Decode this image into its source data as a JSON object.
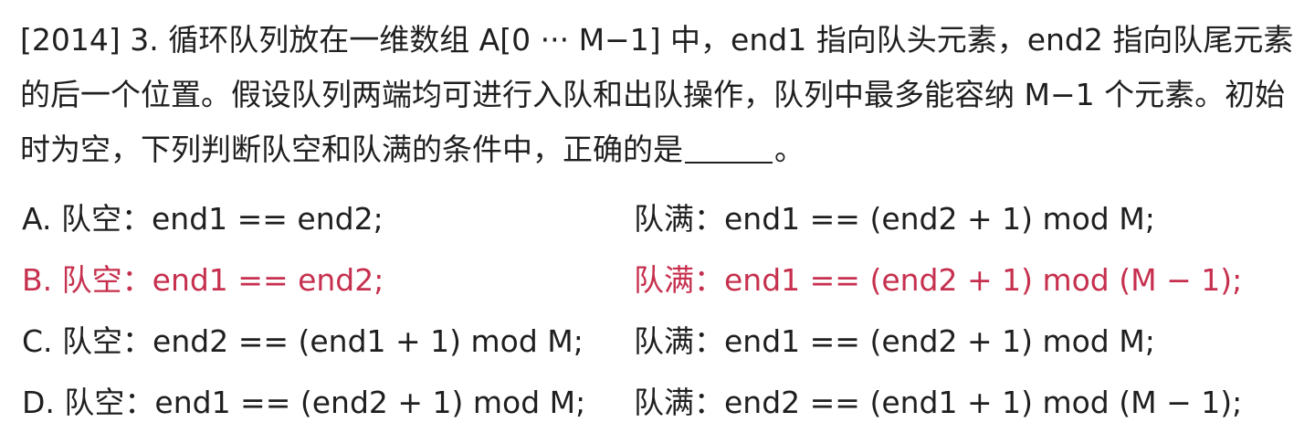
{
  "question": {
    "text": "[2014] 3. 循环队列放在一维数组 A[0 ··· M−1] 中，end1 指向队头元素，end2 指向队尾元素的后一个位置。假设队列两端均可进行入队和出队操作，队列中最多能容纳 M−1 个元素。初始时为空，下列判断队空和队满的条件中，正确的是",
    "tail": "。"
  },
  "options": [
    {
      "label": "A.",
      "empty": "队空：end1 == end2;",
      "full": "队满：end1 == (end2 + 1) mod M;",
      "highlight": false
    },
    {
      "label": "B.",
      "empty": "队空：end1 == end2;",
      "full": "队满：end1 == (end2 + 1) mod (M − 1);",
      "highlight": true
    },
    {
      "label": "C.",
      "empty": "队空：end2 == (end1 + 1) mod M;",
      "full": "队满：end1 == (end2 + 1) mod M;",
      "highlight": false
    },
    {
      "label": "D.",
      "empty": "队空：end1 == (end2 + 1) mod M;",
      "full": "队满：end2 == (end1 + 1) mod (M − 1);",
      "highlight": false
    }
  ],
  "colors": {
    "text": "#1f1f1f",
    "highlight": "#c6304e",
    "background": "#ffffff"
  }
}
